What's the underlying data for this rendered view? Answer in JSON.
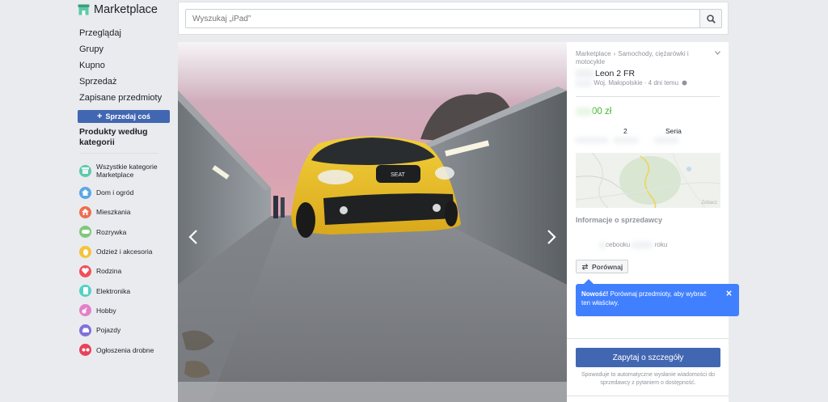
{
  "app": {
    "title": "Marketplace",
    "icon": "shop-icon"
  },
  "nav": [
    {
      "label": "Przeglądaj"
    },
    {
      "label": "Grupy"
    },
    {
      "label": "Kupno"
    },
    {
      "label": "Sprzedaż"
    },
    {
      "label": "Zapisane przedmioty"
    }
  ],
  "sell_button": {
    "label": "Sprzedaj coś"
  },
  "categories_heading": "Produkty według kategorii",
  "categories": [
    {
      "label": "Wszystkie kategorie Marketplace",
      "icon": "marketplace-icon",
      "color": "#5cc9a7"
    },
    {
      "label": "Dom i ogród",
      "icon": "home-icon",
      "color": "#58a6e8"
    },
    {
      "label": "Mieszkania",
      "icon": "house-icon",
      "color": "#f06c4e"
    },
    {
      "label": "Rozrywka",
      "icon": "gamepad-icon",
      "color": "#7ec87a"
    },
    {
      "label": "Odzież i akcesoria",
      "icon": "shirt-icon",
      "color": "#f5c33b"
    },
    {
      "label": "Rodzina",
      "icon": "heart-icon",
      "color": "#f04f5a"
    },
    {
      "label": "Elektronika",
      "icon": "phone-icon",
      "color": "#4ed3c6"
    },
    {
      "label": "Hobby",
      "icon": "guitar-icon",
      "color": "#e57ec8"
    },
    {
      "label": "Pojazdy",
      "icon": "car-icon",
      "color": "#7e72d8"
    },
    {
      "label": "Ogłoszenia drobne",
      "icon": "classifieds-icon",
      "color": "#e8425a"
    }
  ],
  "search": {
    "placeholder": "Wyszukaj „iPad”"
  },
  "listing": {
    "breadcrumb": [
      "Marketplace",
      "Samochody, ciężarówki i motocykle"
    ],
    "title": "Leon 2 FR",
    "location": "Woj. Małopolskie · 4 dni temu",
    "price": "00 zł",
    "specs": [
      "2",
      "Seria"
    ]
  },
  "map": {
    "attribution": "Zobacz"
  },
  "seller": {
    "heading": "Informacje o sprzedawcy",
    "line_middle": "cebooku",
    "line_end": "roku"
  },
  "compare_button": {
    "label": "Porównaj"
  },
  "tooltip": {
    "bold": "Nowość!",
    "text": "Porównaj przedmioty, aby wybrać ten właściwy."
  },
  "ask_button": {
    "label": "Zapytaj o szczegóły"
  },
  "ask_note": "Spowoduje to automatyczne wysłanie wiadomości do sprzedawcy z pytaniem o dostępność.",
  "colors": {
    "accent": "#4267b2",
    "price": "#42b72a",
    "tooltip": "#4080ff",
    "background": "#e9ebee"
  }
}
